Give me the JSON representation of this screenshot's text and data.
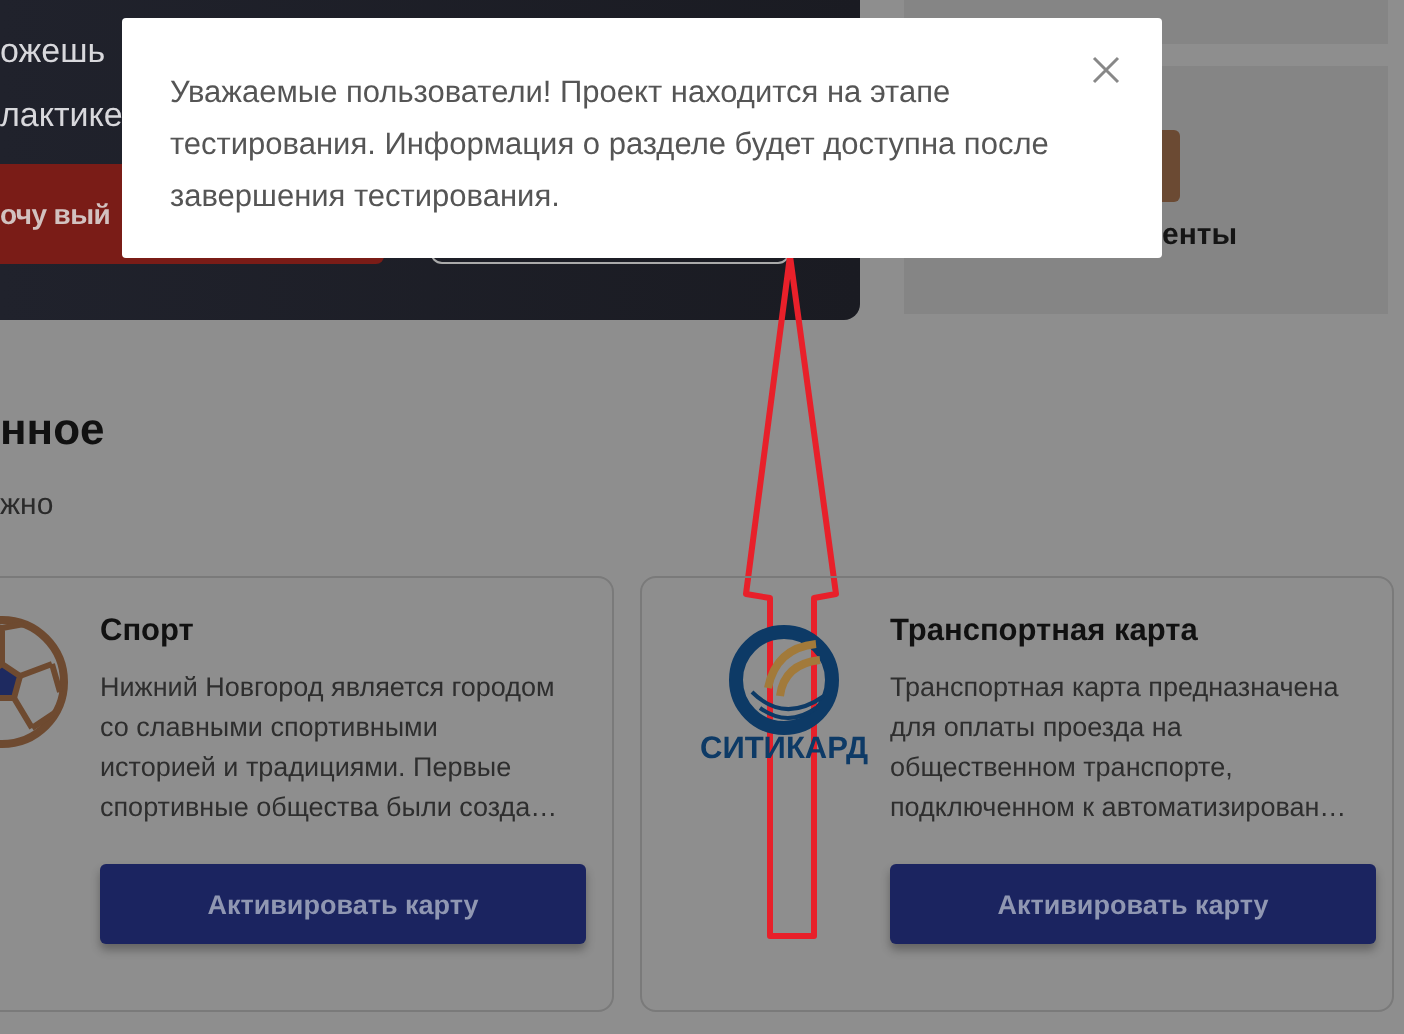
{
  "hero": {
    "text_lines": [
      "ожешь",
      "лактике"
    ],
    "primary_button": "очу вый"
  },
  "side_card": {
    "label": "енты"
  },
  "section": {
    "title": "нное",
    "subtitle": "жно"
  },
  "cards": [
    {
      "kind": "ball",
      "title": "Спорт",
      "description": "Нижний Новгород является городом\nсо славными спортивными\nисторией и традициями. Первые\nспортивные общества были созда…",
      "button": "Активировать карту"
    },
    {
      "kind": "citycard",
      "logo_text": "СИТИКАРД",
      "title": "Транспортная карта",
      "description": "Транспортная карта предназначена\nдля оплаты проезда на\nобщественном транспорте,\nподключенном к автоматизирован…",
      "button": "Активировать карту"
    }
  ],
  "modal": {
    "message": "Уважаемые пользователи! Проект находится на этапе\nтестирования. Информация о разделе будет доступна после\nзавершения тестирования."
  },
  "annotation": {
    "kind": "arrow"
  }
}
